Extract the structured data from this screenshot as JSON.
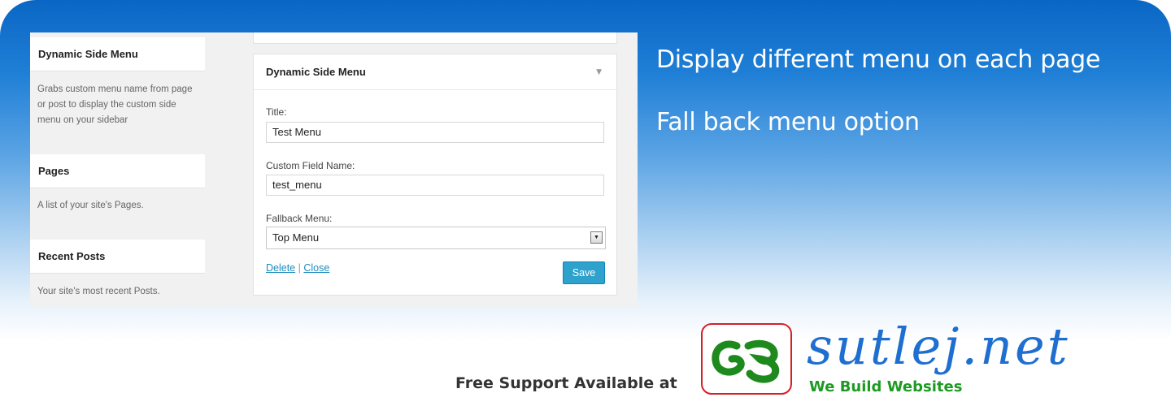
{
  "left_panel": {
    "widgets": [
      {
        "title": "Dynamic Side Menu",
        "desc": "Grabs custom menu name from page or post to display the custom side menu on your sidebar"
      },
      {
        "title": "Pages",
        "desc": "A list of your site's Pages."
      },
      {
        "title": "Recent Posts",
        "desc": "Your site's most recent Posts."
      }
    ]
  },
  "widget_form": {
    "title": "Dynamic Side Menu",
    "title_label": "Title:",
    "title_value": "Test Menu",
    "custom_field_label": "Custom Field Name:",
    "custom_field_value": "test_menu",
    "fallback_label": "Fallback Menu:",
    "fallback_value": "Top Menu",
    "delete_label": "Delete",
    "separator": "|",
    "close_label": "Close",
    "save_label": "Save"
  },
  "headlines": {
    "line1": "Display different menu on each page",
    "line2": "Fall back menu option"
  },
  "footer": {
    "support_text": "Free Support Available at",
    "brand": "sutlej.net",
    "tagline": "We Build Websites"
  },
  "colors": {
    "banner_top": "#0a66c4",
    "save_button": "#2ea2cc",
    "link": "#1e8cbe",
    "brand_blue": "#1f6fd0",
    "brand_green": "#1e9a22",
    "logo_border": "#d71f27"
  }
}
